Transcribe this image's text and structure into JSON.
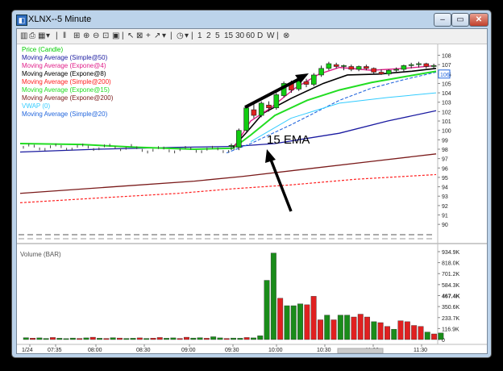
{
  "window": {
    "title": "XLNX--5 Minute",
    "min_glyph": "–",
    "max_glyph": "▭",
    "close_glyph": "✕"
  },
  "toolbar": {
    "periods": [
      "1",
      "2",
      "5",
      "15",
      "30",
      "60",
      "D",
      "W"
    ]
  },
  "price_panel": {
    "legend": [
      {
        "label": "Price (Candle)",
        "color": "#00cc00"
      },
      {
        "label": "Moving Average (Simple@50)",
        "color": "#1a1aa0"
      },
      {
        "label": "Moving Average (Expone@4)",
        "color": "#e0208a"
      },
      {
        "label": "Moving Average (Expone@8)",
        "color": "#000000"
      },
      {
        "label": "Moving Average (Simple@200)",
        "color": "#ff2020"
      },
      {
        "label": "Moving Average (Expone@15)",
        "color": "#22dd22"
      },
      {
        "label": "Moving Average (Expone@200)",
        "color": "#7a1a1a"
      },
      {
        "label": "VWAP (0)",
        "color": "#33ccff"
      },
      {
        "label": "Moving Average (Simple@20)",
        "color": "#2266dd"
      }
    ],
    "annotation": "15 EMA",
    "y_ticks": [
      "108",
      "107",
      "106",
      "105",
      "104",
      "103",
      "102",
      "101",
      "100",
      "99",
      "98",
      "97",
      "96",
      "95",
      "94",
      "93",
      "92",
      "91",
      "90"
    ],
    "last_price": "106"
  },
  "volume_panel": {
    "label": "Volume (BAR)",
    "y_ticks": [
      "934.9K",
      "818.0K",
      "701.2K",
      "584.3K",
      "467.4K",
      "350.6K",
      "233.7K",
      "116.9K",
      "0"
    ],
    "highlight_tick": "467.4K"
  },
  "x_axis": {
    "labels": [
      "1/24",
      "07:35",
      "08:00",
      "08:30",
      "09:00",
      "09:30",
      "10:00",
      "10:30",
      "11:00",
      "11:30"
    ]
  },
  "chart_data": {
    "type": "candlestick",
    "price_ylim": [
      89.5,
      108.3
    ],
    "volume_ylim": [
      0,
      934900
    ],
    "candles": [
      {
        "time": "09:25",
        "open": 98.3,
        "high": 98.6,
        "low": 97.9,
        "close": 98.4
      },
      {
        "time": "09:35",
        "open": 98.2,
        "high": 100.2,
        "low": 97.9,
        "close": 100.0
      },
      {
        "time": "09:40",
        "open": 100.0,
        "high": 102.6,
        "low": 99.9,
        "close": 102.4
      },
      {
        "time": "09:45",
        "open": 102.2,
        "high": 103.0,
        "low": 101.3,
        "close": 101.6
      },
      {
        "time": "09:50",
        "open": 101.6,
        "high": 103.1,
        "low": 101.4,
        "close": 102.9
      },
      {
        "time": "09:55",
        "open": 102.7,
        "high": 103.1,
        "low": 102.0,
        "close": 102.4
      },
      {
        "time": "10:00",
        "open": 102.4,
        "high": 104.0,
        "low": 102.2,
        "close": 103.8
      },
      {
        "time": "10:05",
        "open": 103.7,
        "high": 105.2,
        "low": 103.5,
        "close": 105.0
      },
      {
        "time": "10:10",
        "open": 105.0,
        "high": 105.3,
        "low": 104.0,
        "close": 104.3
      },
      {
        "time": "10:15",
        "open": 104.4,
        "high": 105.6,
        "low": 104.2,
        "close": 105.4
      },
      {
        "time": "10:20",
        "open": 105.2,
        "high": 105.5,
        "low": 104.6,
        "close": 104.9
      },
      {
        "time": "10:25",
        "open": 104.9,
        "high": 106.1,
        "low": 104.7,
        "close": 105.9
      },
      {
        "time": "10:30",
        "open": 105.9,
        "high": 106.9,
        "low": 105.7,
        "close": 106.6
      },
      {
        "time": "10:35",
        "open": 106.6,
        "high": 107.3,
        "low": 106.4,
        "close": 107.1
      },
      {
        "time": "10:40",
        "open": 107.0,
        "high": 107.2,
        "low": 106.6,
        "close": 106.8
      },
      {
        "time": "10:45",
        "open": 106.8,
        "high": 107.0,
        "low": 106.4,
        "close": 106.9
      },
      {
        "time": "10:50",
        "open": 106.8,
        "high": 107.0,
        "low": 106.3,
        "close": 106.5
      },
      {
        "time": "10:55",
        "open": 106.5,
        "high": 106.9,
        "low": 106.3,
        "close": 106.8
      },
      {
        "time": "11:00",
        "open": 106.8,
        "high": 107.0,
        "low": 106.4,
        "close": 106.6
      },
      {
        "time": "11:05",
        "open": 106.6,
        "high": 106.7,
        "low": 106.0,
        "close": 106.2
      },
      {
        "time": "11:10",
        "open": 106.2,
        "high": 106.5,
        "low": 105.9,
        "close": 106.0
      },
      {
        "time": "11:15",
        "open": 106.0,
        "high": 106.5,
        "low": 105.8,
        "close": 106.4
      },
      {
        "time": "11:20",
        "open": 106.4,
        "high": 106.7,
        "low": 106.1,
        "close": 106.5
      },
      {
        "time": "11:25",
        "open": 106.5,
        "high": 107.0,
        "low": 106.3,
        "close": 106.9
      },
      {
        "time": "11:30",
        "open": 106.9,
        "high": 107.2,
        "low": 106.6,
        "close": 107.0
      },
      {
        "time": "11:35",
        "open": 107.0,
        "high": 107.3,
        "low": 106.7,
        "close": 107.1
      },
      {
        "time": "11:40",
        "open": 107.1,
        "high": 107.2,
        "low": 106.6,
        "close": 106.8
      },
      {
        "time": "11:45",
        "open": 106.8,
        "high": 107.1,
        "low": 106.6,
        "close": 106.9
      }
    ],
    "volume_bars": [
      {
        "v": 20000,
        "up": true
      },
      {
        "v": 15000,
        "up": false
      },
      {
        "v": 18000,
        "up": true
      },
      {
        "v": 12000,
        "up": true
      },
      {
        "v": 22000,
        "up": false
      },
      {
        "v": 14000,
        "up": true
      },
      {
        "v": 10000,
        "up": true
      },
      {
        "v": 16000,
        "up": true
      },
      {
        "v": 12000,
        "up": false
      },
      {
        "v": 18000,
        "up": true
      },
      {
        "v": 25000,
        "up": false
      },
      {
        "v": 14000,
        "up": true
      },
      {
        "v": 12000,
        "up": false
      },
      {
        "v": 20000,
        "up": true
      },
      {
        "v": 16000,
        "up": false
      },
      {
        "v": 12000,
        "up": true
      },
      {
        "v": 14000,
        "up": true
      },
      {
        "v": 18000,
        "up": false
      },
      {
        "v": 12000,
        "up": true
      },
      {
        "v": 15000,
        "up": false
      },
      {
        "v": 22000,
        "up": false
      },
      {
        "v": 14000,
        "up": true
      },
      {
        "v": 18000,
        "up": true
      },
      {
        "v": 12000,
        "up": false
      },
      {
        "v": 25000,
        "up": false
      },
      {
        "v": 16000,
        "up": true
      },
      {
        "v": 20000,
        "up": true
      },
      {
        "v": 14000,
        "up": false
      },
      {
        "v": 30000,
        "up": true
      },
      {
        "v": 18000,
        "up": true
      },
      {
        "v": 12000,
        "up": false
      },
      {
        "v": 16000,
        "up": true
      },
      {
        "v": 14000,
        "up": true
      },
      {
        "v": 22000,
        "up": false
      },
      {
        "v": 18000,
        "up": true
      },
      {
        "v": 40000,
        "up": true
      },
      {
        "v": 630000,
        "up": true
      },
      {
        "v": 920000,
        "up": true
      },
      {
        "v": 440000,
        "up": false
      },
      {
        "v": 360000,
        "up": true
      },
      {
        "v": 360000,
        "up": true
      },
      {
        "v": 380000,
        "up": true
      },
      {
        "v": 370000,
        "up": false
      },
      {
        "v": 460000,
        "up": false
      },
      {
        "v": 210000,
        "up": false
      },
      {
        "v": 260000,
        "up": true
      },
      {
        "v": 210000,
        "up": false
      },
      {
        "v": 260000,
        "up": true
      },
      {
        "v": 260000,
        "up": true
      },
      {
        "v": 240000,
        "up": false
      },
      {
        "v": 270000,
        "up": false
      },
      {
        "v": 240000,
        "up": false
      },
      {
        "v": 190000,
        "up": true
      },
      {
        "v": 180000,
        "up": false
      },
      {
        "v": 140000,
        "up": false
      },
      {
        "v": 110000,
        "up": true
      },
      {
        "v": 200000,
        "up": false
      },
      {
        "v": 190000,
        "up": false
      },
      {
        "v": 150000,
        "up": false
      },
      {
        "v": 140000,
        "up": false
      },
      {
        "v": 80000,
        "up": true
      },
      {
        "v": 60000,
        "up": false
      },
      {
        "v": 70000,
        "up": true
      }
    ]
  }
}
